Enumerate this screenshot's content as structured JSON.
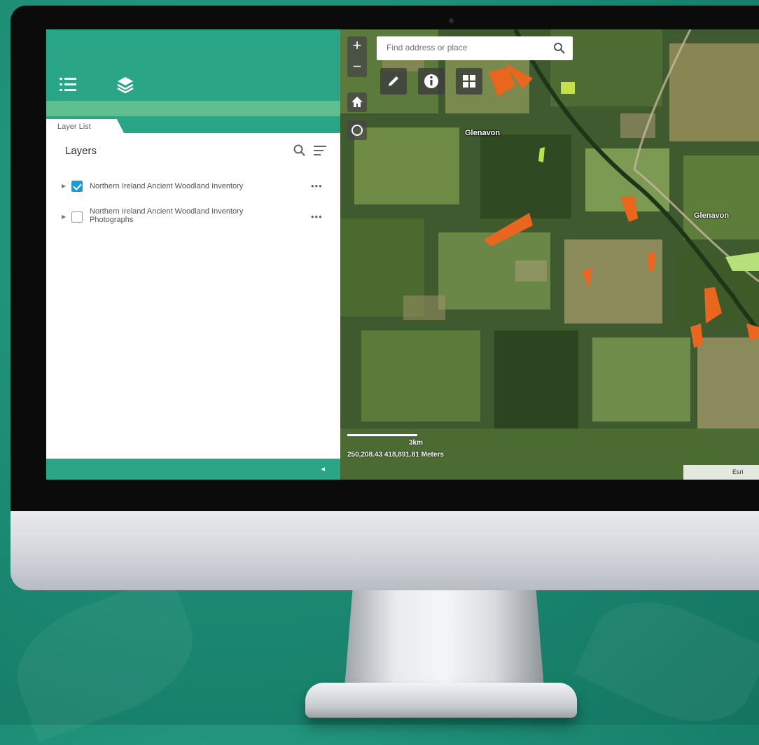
{
  "panel": {
    "tab_label": "Layer List",
    "title": "Layers",
    "layers": [
      {
        "name": "Northern Ireland Ancient Woodland Inventory",
        "checked": true
      },
      {
        "name": "Northern Ireland Ancient Woodland Inventory Photographs",
        "checked": false
      }
    ],
    "more_label": "•••",
    "collapse_label": "◂"
  },
  "map": {
    "search_placeholder": "Find address or place",
    "zoom_in": "+",
    "zoom_out": "−",
    "place_labels": [
      "Glenavon",
      "Glenavon"
    ],
    "scale_label": "3km",
    "coordinates": "250,208.43 418,891.81 Meters",
    "attribution": "Esri"
  },
  "colors": {
    "brand": "#2aa585",
    "accent_stripe": "#5fbf8f",
    "checkbox": "#1e9bd1",
    "woodland": "#e8661e"
  },
  "icons": {
    "header": [
      "layer-list-icon",
      "layers-icon"
    ],
    "map_tools": [
      "draw-icon",
      "info-icon",
      "basemap-gallery-icon"
    ],
    "map_nav": [
      "home-icon",
      "locate-icon"
    ]
  }
}
